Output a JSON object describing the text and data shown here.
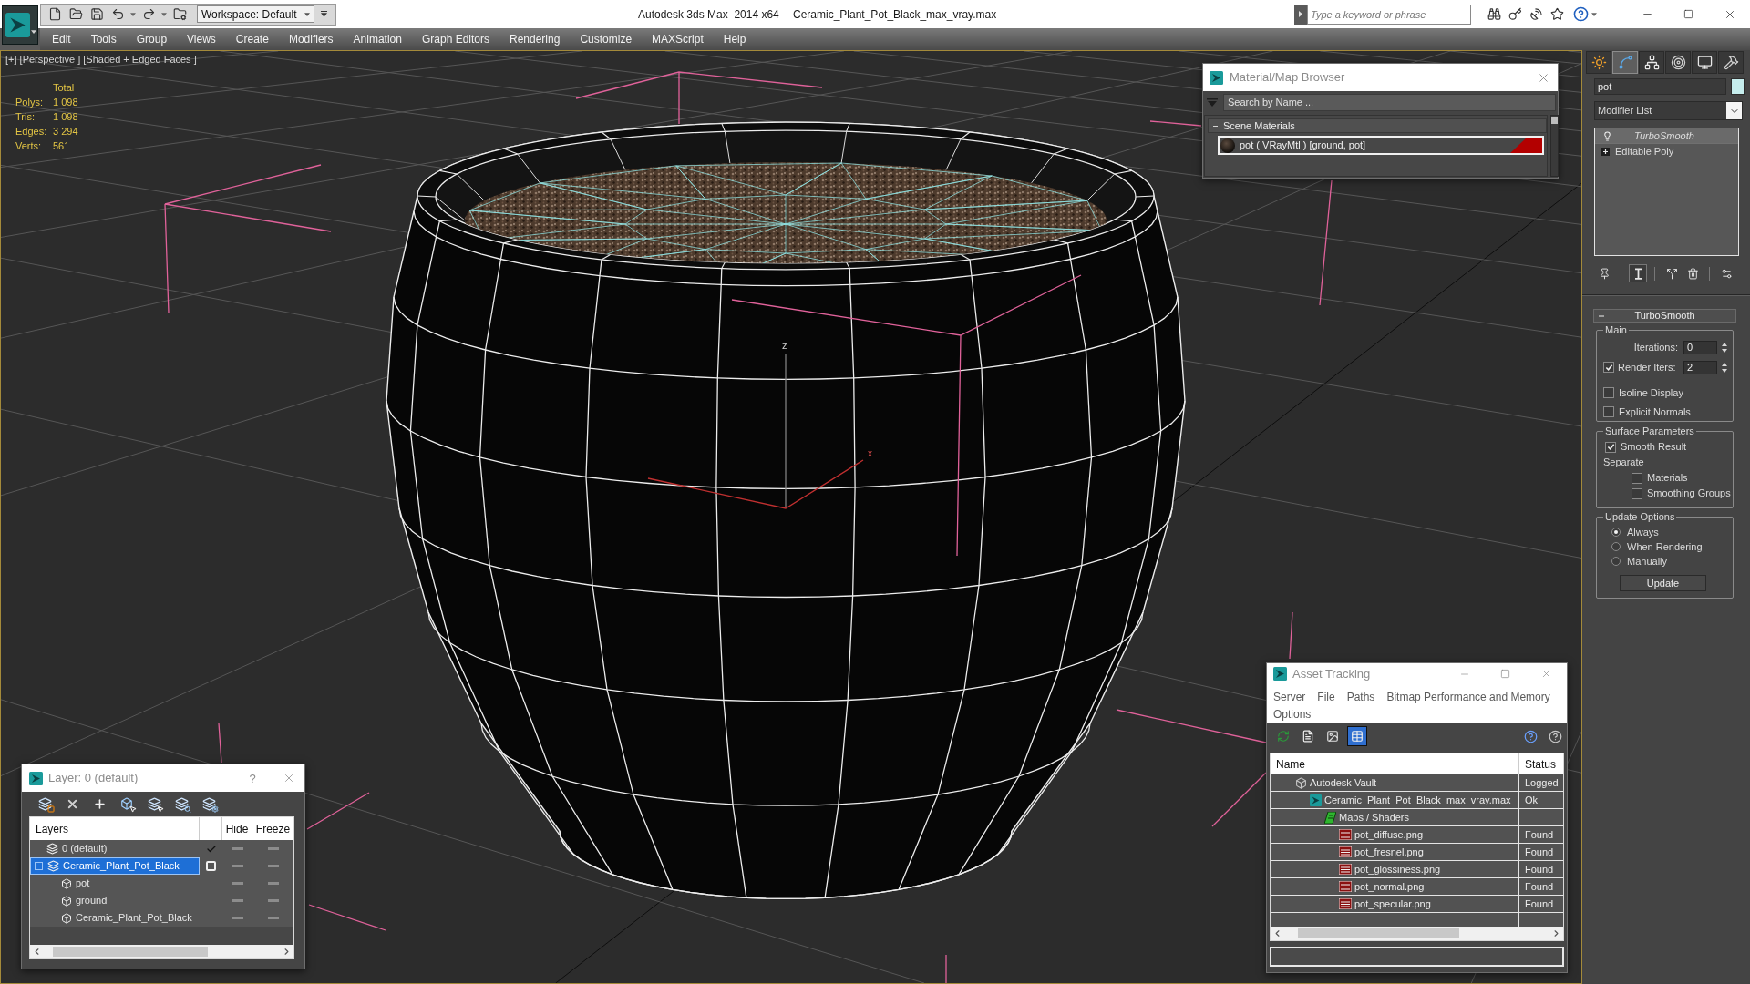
{
  "title_bar": {
    "workspace": "Workspace: Default",
    "app_title": "Autodesk 3ds Max  2014 x64",
    "file_name": "Ceramic_Plant_Pot_Black_max_vray.max",
    "search": {
      "placeholder": "Type a keyword or phrase"
    }
  },
  "menu_bar": [
    "Edit",
    "Tools",
    "Group",
    "Views",
    "Create",
    "Modifiers",
    "Animation",
    "Graph Editors",
    "Rendering",
    "Customize",
    "MAXScript",
    "Help"
  ],
  "viewport": {
    "label": "[+] [Perspective ] [Shaded + Edged Faces ]",
    "stats": {
      "header": "Total",
      "rows": [
        {
          "label": "Polys:",
          "value": "1 098"
        },
        {
          "label": "Tris:",
          "value": "1 098"
        },
        {
          "label": "Edges:",
          "value": "3 294"
        },
        {
          "label": "Verts:",
          "value": "561"
        }
      ]
    },
    "axis_labels": [
      "z",
      "x"
    ]
  },
  "material_browser": {
    "title": "Material/Map Browser",
    "search": {
      "placeholder": "Search by Name ..."
    },
    "group": {
      "label": "Scene Materials",
      "expanded": true
    },
    "materials": [
      {
        "name": "pot ( VRayMtl ) [ground, pot]",
        "selected": true
      }
    ]
  },
  "command_panel": {
    "tabs": [
      {
        "kind": "create",
        "selected": false
      },
      {
        "kind": "modify",
        "selected": true
      },
      {
        "kind": "hierarchy",
        "selected": false
      },
      {
        "kind": "motion",
        "selected": false
      },
      {
        "kind": "display",
        "selected": false
      },
      {
        "kind": "utilities",
        "selected": false
      }
    ],
    "object_name": "pot",
    "modifier_list": "Modifier List",
    "modifier_stack": [
      {
        "kind": "modifier",
        "name": "TurboSmooth",
        "selected": true
      },
      {
        "kind": "base",
        "name": "Editable Poly",
        "selected": false,
        "expanded": false
      }
    ],
    "stack_tools": [
      {
        "kind": "pin",
        "on": false
      },
      {
        "kind": "end_result",
        "on": true
      },
      {
        "kind": "make_unique",
        "on": false
      },
      {
        "kind": "remove",
        "on": false
      },
      {
        "kind": "configure",
        "on": false
      }
    ],
    "rollout": {
      "title": "TurboSmooth",
      "expanded": true,
      "main": {
        "label": "Main",
        "iterations": {
          "label": "Iterations:",
          "value": "0"
        },
        "render_iters": {
          "label": "Render Iters:",
          "value": "2",
          "checked": true
        },
        "options": [
          {
            "label": "Isoline Display",
            "checked": false
          },
          {
            "label": "Explicit Normals",
            "checked": false
          }
        ]
      },
      "surface": {
        "label": "Surface Parameters",
        "smooth_result": {
          "label": "Smooth Result",
          "checked": true
        },
        "separate": "Separate",
        "options": [
          {
            "label": "Materials",
            "checked": false
          },
          {
            "label": "Smoothing Groups",
            "checked": false
          }
        ]
      },
      "update": {
        "label": "Update Options",
        "options": [
          {
            "label": "Always",
            "selected": true
          },
          {
            "label": "When Rendering",
            "selected": false
          },
          {
            "label": "Manually",
            "selected": false
          }
        ],
        "button": "Update"
      }
    }
  },
  "asset_tracking": {
    "title": "Asset Tracking",
    "menu": [
      "Server",
      "File",
      "Paths",
      "Bitmap Performance and Memory",
      "Options"
    ],
    "toolbar": [
      {
        "kind": "refresh",
        "selected": false
      },
      {
        "kind": "list",
        "selected": false
      },
      {
        "kind": "thumbnail",
        "selected": false
      },
      {
        "kind": "table",
        "selected": true
      }
    ],
    "columns": {
      "name": "Name",
      "status": "Status"
    },
    "tree": [
      {
        "kind": "vault",
        "name": "Autodesk Vault",
        "status": "Logged",
        "children": [
          {
            "kind": "max_file",
            "name": "Ceramic_Plant_Pot_Black_max_vray.max",
            "status": "Ok",
            "children": [
              {
                "kind": "folder",
                "name": "Maps / Shaders",
                "children": [
                  {
                    "kind": "png",
                    "name": "pot_diffuse.png",
                    "status": "Found"
                  },
                  {
                    "kind": "png",
                    "name": "pot_fresnel.png",
                    "status": "Found"
                  },
                  {
                    "kind": "png",
                    "name": "pot_glossiness.png",
                    "status": "Found"
                  },
                  {
                    "kind": "png",
                    "name": "pot_normal.png",
                    "status": "Found"
                  },
                  {
                    "kind": "png",
                    "name": "pot_specular.png",
                    "status": "Found"
                  }
                ]
              }
            ]
          }
        ]
      }
    ]
  },
  "layer_dialog": {
    "title": "Layer: 0 (default)",
    "help": "?",
    "columns": {
      "name": "Layers",
      "hide": "Hide",
      "freeze": "Freeze"
    },
    "layers": [
      {
        "kind": "layer",
        "name": "0 (default)",
        "current": true,
        "selected": false,
        "hidden": false,
        "frozen": false
      },
      {
        "kind": "layer",
        "name": "Ceramic_Plant_Pot_Black",
        "current": false,
        "selected": true,
        "expanded": true,
        "hidden": false,
        "frozen": false,
        "children": [
          {
            "kind": "object",
            "name": "pot",
            "selected": false,
            "hidden": false,
            "frozen": false
          },
          {
            "kind": "object",
            "name": "ground",
            "selected": false,
            "hidden": false,
            "frozen": false
          },
          {
            "kind": "object",
            "name": "Ceramic_Plant_Pot_Black",
            "selected": false,
            "hidden": false,
            "frozen": false
          }
        ]
      }
    ]
  }
}
